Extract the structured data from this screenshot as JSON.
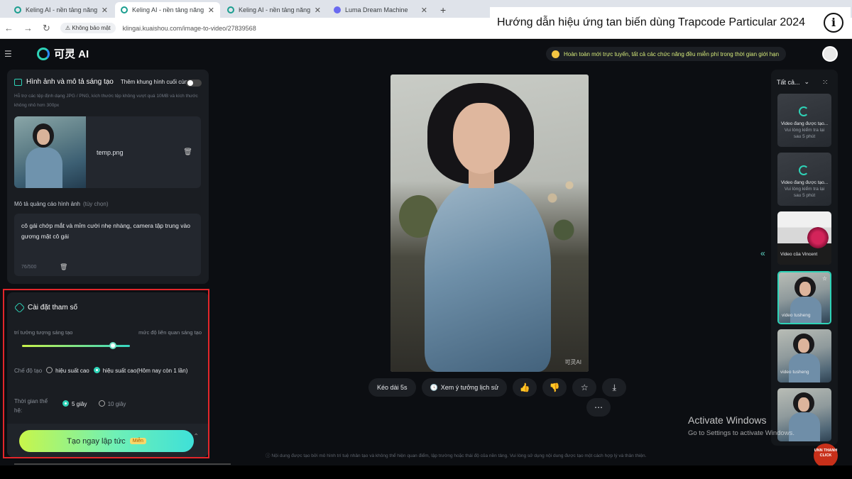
{
  "browser": {
    "tabs": [
      {
        "title": "Keling AI - nền tảng năng suất",
        "active": false
      },
      {
        "title": "Keling AI - nền tảng năng suất",
        "active": true
      },
      {
        "title": "Keling AI - nền tảng năng suất",
        "active": false
      },
      {
        "title": "Luma Dream Machine",
        "active": false
      }
    ],
    "new_tab": "+",
    "security_label": "Không bảo mật",
    "url": "klingai.kuaishou.com/image-to-video/27839568"
  },
  "video_overlay": {
    "title": "Hướng dẫn hiệu ứng tan biến dùng Trapcode Particular 2024",
    "info_icon": "i"
  },
  "app": {
    "logo_text": "可灵 AI",
    "promo_text": "Hoàn toàn mới trực tuyến, tất cả các chức năng đều miễn phí trong thời gian giới hạn"
  },
  "upload_card": {
    "title": "Hình ảnh và mô tả sáng tạo",
    "toggle_label": "Thêm khung hình cuối cùng",
    "note": "Hỗ trợ các tệp định dạng JPG / PNG, kích thước tệp không vượt quá 10MB và kích thước không nhỏ hơn 300px",
    "file_name": "temp.png",
    "desc_label": "Mô tả quảng cáo hình ảnh",
    "desc_optional": "(tùy chọn)",
    "desc_text": "cô gái chớp mắt và mỉm cười nhẹ nhàng, camera tập trung vào gương mặt cô gái",
    "desc_count": "76/500"
  },
  "settings": {
    "title": "Cài đặt tham số",
    "slider_left": "trí tưởng tượng sáng tạo",
    "slider_right": "mức độ liên quan sáng tạo",
    "slider_value": 0.84,
    "mode_label": "Chế độ tạo",
    "mode_option_1": "hiệu suất cao",
    "mode_option_2": "hiệu suất cao(Hôm nay còn 1 lần)",
    "duration_label": "Thời gian thể hệ:",
    "duration_option_1": "5 giây",
    "duration_option_2": "10 giây",
    "generate_label": "Tạo ngay lập tức",
    "free_badge": "Miễn"
  },
  "preview": {
    "watermark": "可灵AI",
    "action_duration": "Kéo dài 5s",
    "action_history": "Xem ý tưởng lịch sử",
    "disclaimer": "Nội dung được tạo bởi mô hình trí tuệ nhân tạo và không thể hiện quan điểm, lập trường hoặc thái độ của nền tảng. Vui lòng sử dụng nội dung được tạo một cách hợp lý và thân thiện."
  },
  "history": {
    "filter": "Tất cả...",
    "items": [
      {
        "type": "generating",
        "caption": "Video đang được tạo...",
        "sub": "Vui lòng kiểm tra lại sau 5 phút"
      },
      {
        "type": "generating",
        "caption": "Video đang được tạo...",
        "sub": "Vui lòng kiểm tra lại sau 5 phút"
      },
      {
        "type": "flower",
        "caption": "Video của Vincent",
        "sub": ""
      },
      {
        "type": "photo",
        "caption": "video tusheng",
        "sub": "",
        "selected": true
      },
      {
        "type": "photo",
        "caption": "video tusheng",
        "sub": ""
      },
      {
        "type": "photo",
        "caption": "",
        "sub": ""
      }
    ]
  },
  "system": {
    "activate_title": "Activate Windows",
    "activate_sub": "Go to Settings to activate Windows.",
    "channel_badge": "UNN THANH CLICK"
  },
  "colors": {
    "accent": "#2ed3b7",
    "highlight_frame": "#e3262a",
    "background": "#0c0e12"
  }
}
